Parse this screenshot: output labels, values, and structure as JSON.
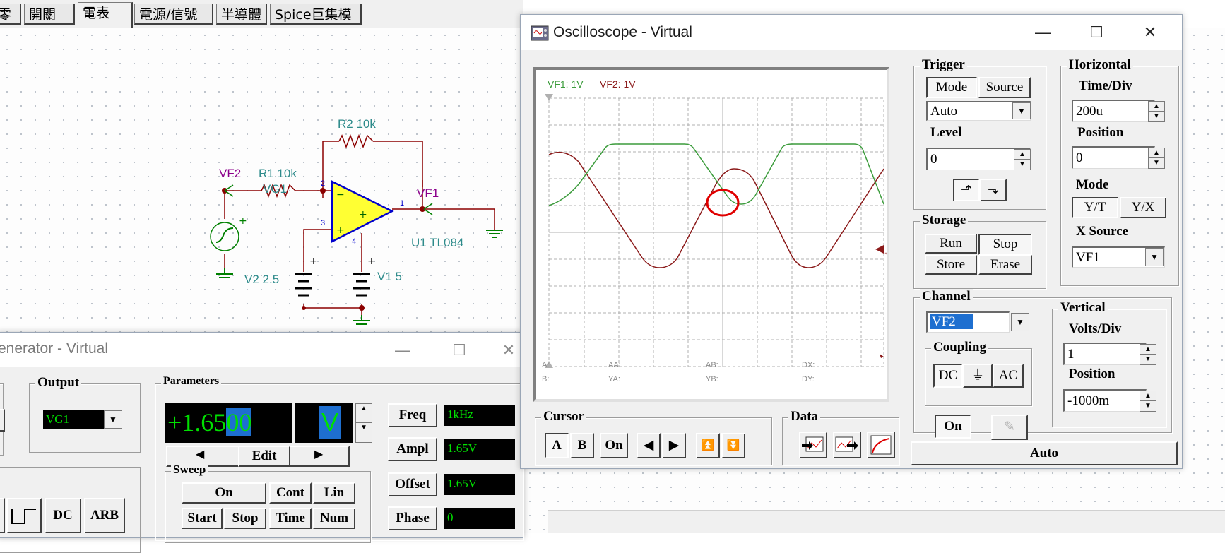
{
  "toolbar": {
    "tabs": [
      "零件",
      "開關",
      "電表",
      "電源/信號源",
      "半導體",
      "Spice巨集模組"
    ]
  },
  "circuit": {
    "r2": "R2 10k",
    "r1": "R1 10k",
    "vf2": "VF2",
    "vg1": "VG1",
    "vf1": "VF1",
    "u1": "U1 TL084",
    "v2": "V2 2.5",
    "v1": "V1 5",
    "pin2": "2",
    "pin3": "3",
    "pin1": "1",
    "pin4": "4"
  },
  "oscilloscope": {
    "title": "Oscilloscope - Virtual",
    "screen": {
      "channel_info_1": "VF1: 1V",
      "channel_info_2": "VF2: 1V",
      "readouts": {
        "a": "A:",
        "aa": "AA:",
        "ab": "AB:",
        "dx": "DX:",
        "b": "B:",
        "ya": "YA:",
        "yb": "YB:",
        "dy": "DY:"
      }
    },
    "trigger": {
      "legend": "Trigger",
      "mode_button": "Mode",
      "source_button": "Source",
      "mode_value": "Auto",
      "level_label": "Level",
      "level_value": "0"
    },
    "horizontal": {
      "legend": "Horizontal",
      "time_div_label": "Time/Div",
      "time_div_value": "200u",
      "position_label": "Position",
      "position_value": "0",
      "mode_label": "Mode",
      "yt_button": "Y/T",
      "yx_button": "Y/X",
      "xsource_label": "X Source",
      "xsource_value": "VF1"
    },
    "storage": {
      "legend": "Storage",
      "run": "Run",
      "stop": "Stop",
      "store": "Store",
      "erase": "Erase"
    },
    "channel": {
      "legend": "Channel",
      "selected": "VF2",
      "coupling_legend": "Coupling",
      "dc": "DC",
      "gnd": "⏚",
      "ac": "AC",
      "on": "On"
    },
    "vertical": {
      "legend": "Vertical",
      "volts_div_label": "Volts/Div",
      "volts_div_value": "1",
      "position_label": "Position",
      "position_value": "-1000m"
    },
    "cursor": {
      "legend": "Cursor",
      "a": "A",
      "b": "B",
      "on": "On"
    },
    "data": {
      "legend": "Data"
    },
    "auto_button": "Auto"
  },
  "generator": {
    "title": "enerator - Virtual",
    "output_legend": "Output",
    "output_value": "VG1",
    "parameters_legend": "Parameters",
    "display_value_a": "+1.65",
    "display_value_b": "00",
    "display_unit": "V",
    "edit_button": "Edit",
    "freq_button": "Freq",
    "freq_value": "1kHz",
    "ampl_button": "Ampl",
    "ampl_value": "1.65V",
    "offset_button": "Offset",
    "offset_value": "1.65V",
    "phase_button": "Phase",
    "phase_value": "0",
    "sweep_legend": "Sweep",
    "sweep_on": "On",
    "sweep_cont": "Cont",
    "sweep_lin": "Lin",
    "sweep_start": "Start",
    "sweep_stop": "Stop",
    "sweep_time": "Time",
    "sweep_num": "Num",
    "dc_button": "DC",
    "arb_button": "ARB"
  }
}
